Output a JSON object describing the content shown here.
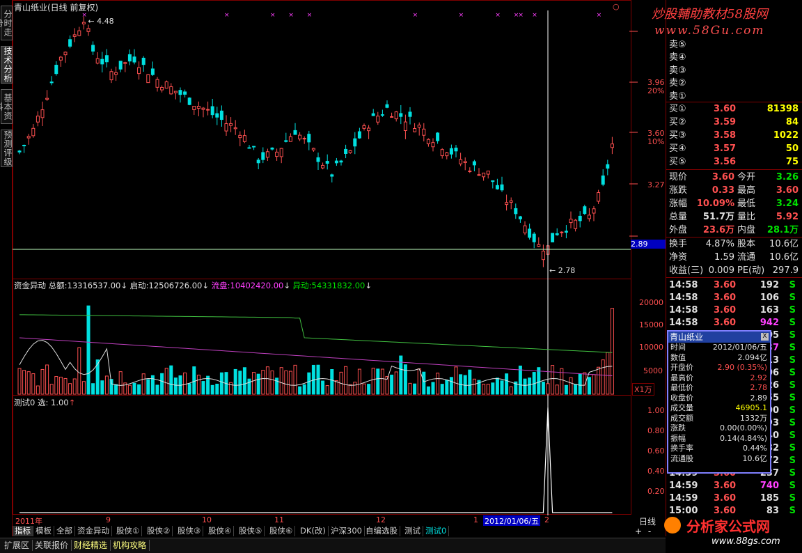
{
  "left_tabs": [
    "分时走势",
    "技术分析",
    "基本资料",
    "预测评级"
  ],
  "main_title": "青山纸业(日线 前复权)",
  "price_labels": {
    "high": "4.48",
    "low": "2.78",
    "cursor": "2.89"
  },
  "price_axis": [
    "3.96",
    "20%",
    "3.60",
    "10%",
    "3.27"
  ],
  "indicator_header": {
    "name": "资金异动",
    "l1": "总额:",
    "v1": "13316537.00",
    "l2": "启动:",
    "v2": "12506726.00",
    "l3": "流盘:",
    "v3": "10402420.00",
    "l4": "异动:",
    "v4": "54331832.00"
  },
  "vol_axis": [
    "20000",
    "15000",
    "10000",
    "5000"
  ],
  "vol_unit": "X1万",
  "test_header": "测试0 选: 1.00",
  "test_axis": [
    "1.00",
    "0.80",
    "0.60",
    "0.40",
    "0.20"
  ],
  "date_axis": [
    "2011年",
    "9",
    "10",
    "11",
    "12",
    "1",
    "2"
  ],
  "date_cursor": "2012/01/06/五",
  "period_label": "日线",
  "nav": {
    "plus": "+",
    "minus": "-",
    "circle": "○"
  },
  "formula_tabs": [
    "指标",
    "模板",
    "全部",
    "资金异动",
    "股侠①",
    "股侠②",
    "股侠③",
    "股侠④",
    "股侠⑤",
    "股侠⑥",
    "DK(改)",
    "沪深300",
    "自编选股",
    "测试",
    "测试0"
  ],
  "bottom_tabs": [
    "扩展区",
    "关联报价",
    "财经精选",
    "机构攻略"
  ],
  "logo_top": {
    "title": "炒股輔助教材58股网",
    "url": "www.58Gu.com"
  },
  "logo_bottom": {
    "title": "分析家公式网",
    "url": "www.88gs.com"
  },
  "order_book": {
    "asks": [
      "卖⑤",
      "卖④",
      "卖③",
      "卖②",
      "卖①"
    ],
    "bids": [
      {
        "label": "买①",
        "price": "3.60",
        "vol": "81398"
      },
      {
        "label": "买②",
        "price": "3.59",
        "vol": "84"
      },
      {
        "label": "买③",
        "price": "3.58",
        "vol": "1022"
      },
      {
        "label": "买④",
        "price": "3.57",
        "vol": "50"
      },
      {
        "label": "买⑤",
        "price": "3.56",
        "vol": "75"
      }
    ]
  },
  "quote": [
    {
      "l1": "现价",
      "v1": "3.60",
      "c1": "red",
      "l2": "今开",
      "v2": "3.26",
      "c2": "grn"
    },
    {
      "l1": "涨跌",
      "v1": "0.33",
      "c1": "red",
      "l2": "最高",
      "v2": "3.60",
      "c2": "red"
    },
    {
      "l1": "涨幅",
      "v1": "10.09%",
      "c1": "red",
      "l2": "最低",
      "v2": "3.24",
      "c2": "grn"
    },
    {
      "l1": "总量",
      "v1": "51.7万",
      "c1": "wht",
      "l2": "量比",
      "v2": "5.92",
      "c2": "red"
    },
    {
      "l1": "外盘",
      "v1": "23.6万",
      "c1": "red",
      "l2": "内盘",
      "v2": "28.1万",
      "c2": "grn"
    }
  ],
  "fundamentals": [
    {
      "l1": "换手",
      "v1": "4.87%",
      "l2": "股本",
      "v2": "10.6亿"
    },
    {
      "l1": "净资",
      "v1": "1.59",
      "l2": "流通",
      "v2": "10.6亿"
    },
    {
      "l1": "收益(三)",
      "v1": "0.009",
      "l2": "PE(动)",
      "v2": "297.9"
    }
  ],
  "ticks": [
    {
      "t": "14:58",
      "p": "3.60",
      "v": "192",
      "s": "S",
      "vc": "wht"
    },
    {
      "t": "14:58",
      "p": "3.60",
      "v": "106",
      "s": "S",
      "vc": "wht"
    },
    {
      "t": "14:58",
      "p": "3.60",
      "v": "163",
      "s": "S",
      "vc": "wht"
    },
    {
      "t": "14:58",
      "p": "3.60",
      "v": "942",
      "s": "S",
      "vc": "mag"
    },
    {
      "t": "14:58",
      "p": "3.60",
      "v": "205",
      "s": "S",
      "vc": "wht"
    },
    {
      "t": "14:58",
      "p": "3.60",
      "v": "937",
      "s": "S",
      "vc": "mag"
    },
    {
      "t": "14:58",
      "p": "3.60",
      "v": "413",
      "s": "S",
      "vc": "wht"
    },
    {
      "t": "14:58",
      "p": "3.60",
      "v": "206",
      "s": "S",
      "vc": "wht"
    },
    {
      "t": "14:58",
      "p": "3.60",
      "v": "326",
      "s": "S",
      "vc": "wht"
    },
    {
      "t": "14:58",
      "p": "3.60",
      "v": "155",
      "s": "S",
      "vc": "wht"
    },
    {
      "t": "14:58",
      "p": "3.60",
      "v": "200",
      "s": "S",
      "vc": "wht"
    },
    {
      "t": "14:58",
      "p": "3.60",
      "v": "193",
      "s": "S",
      "vc": "wht"
    },
    {
      "t": "14:58",
      "p": "3.60",
      "v": "440",
      "s": "S",
      "vc": "wht"
    },
    {
      "t": "14:58",
      "p": "3.60",
      "v": "182",
      "s": "S",
      "vc": "wht"
    },
    {
      "t": "14:58",
      "p": "3.60",
      "v": "72",
      "s": "S",
      "vc": "wht"
    },
    {
      "t": "14:59",
      "p": "3.60",
      "v": "237",
      "s": "S",
      "vc": "wht"
    },
    {
      "t": "14:59",
      "p": "3.60",
      "v": "740",
      "s": "S",
      "vc": "mag"
    },
    {
      "t": "14:59",
      "p": "3.60",
      "v": "185",
      "s": "S",
      "vc": "wht"
    },
    {
      "t": "15:00",
      "p": "3.60",
      "v": "83",
      "s": "S",
      "vc": "wht"
    }
  ],
  "popup": {
    "title": "青山纸业",
    "close": "X",
    "rows": [
      {
        "l": "时间",
        "v": "2012/01/06/五",
        "c": "wht"
      },
      {
        "l": "数值",
        "v": "2.094亿",
        "c": "wht"
      },
      {
        "l": "开盘价",
        "v": "2.90 (0.35%)",
        "c": "red"
      },
      {
        "l": "最高价",
        "v": "2.92",
        "c": "red"
      },
      {
        "l": "最低价",
        "v": "2.78",
        "c": "red"
      },
      {
        "l": "收盘价",
        "v": "2.89",
        "c": "wht"
      },
      {
        "l": "成交量",
        "v": "46905.1",
        "c": "yel"
      },
      {
        "l": "成交额",
        "v": "1332万",
        "c": "wht"
      },
      {
        "l": "涨跌",
        "v": "0.00(0.00%)",
        "c": "wht"
      },
      {
        "l": "振幅",
        "v": "0.14(4.84%)",
        "c": "wht"
      },
      {
        "l": "换手率",
        "v": "0.44%",
        "c": "wht"
      },
      {
        "l": "流通股",
        "v": "10.6亿",
        "c": "wht"
      }
    ]
  },
  "colors": {
    "up": "#ff5050",
    "down": "#00e0e0",
    "grid": "#800000",
    "accent": "#8080ff"
  }
}
